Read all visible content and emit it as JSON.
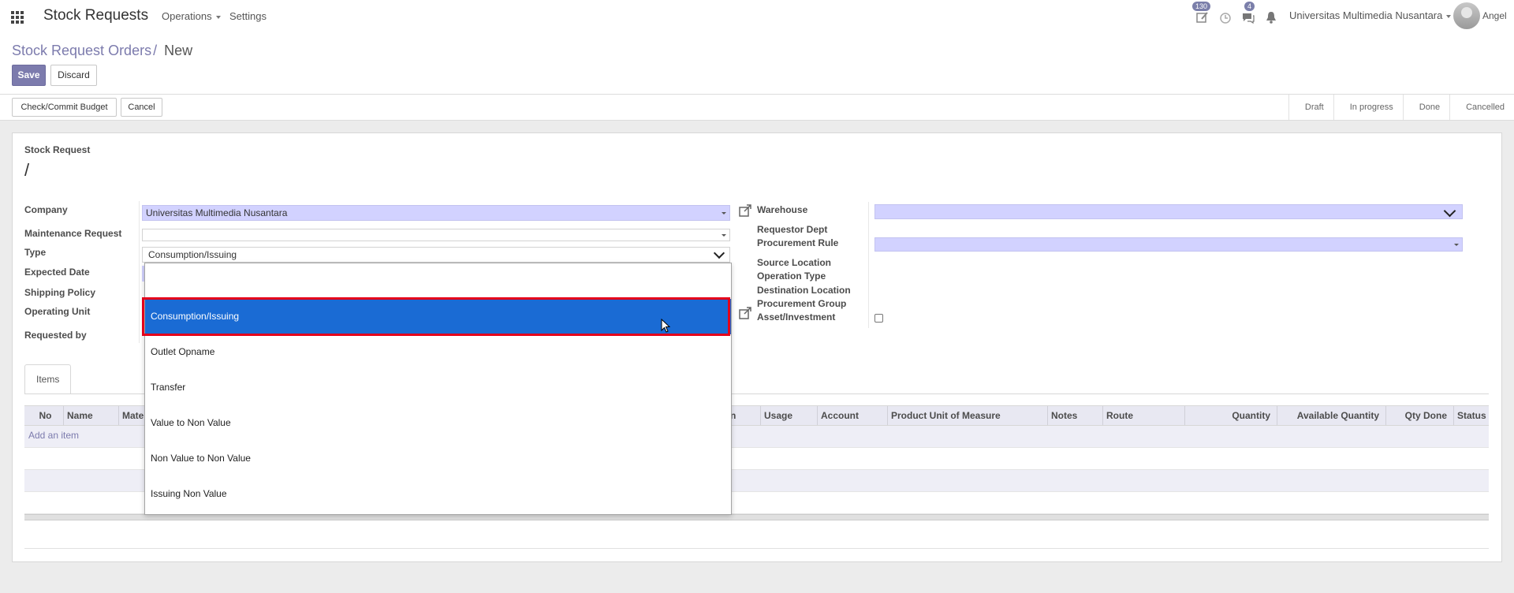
{
  "navbar": {
    "app_title": "Stock Requests",
    "menu_operations": "Operations",
    "menu_settings": "Settings",
    "activity_count": "130",
    "messages_count": "4",
    "company": "Universitas Multimedia Nusantara",
    "user": "Angel"
  },
  "breadcrumb": {
    "parent": "Stock Request Orders",
    "separator": "/",
    "current": "New"
  },
  "buttons": {
    "save": "Save",
    "discard": "Discard",
    "check_budget": "Check/Commit Budget",
    "cancel": "Cancel"
  },
  "statusbar": {
    "stages": [
      "Draft",
      "In progress",
      "Done",
      "Cancelled"
    ]
  },
  "form": {
    "title_label": "Stock Request",
    "name": "/",
    "left_labels": {
      "company": "Company",
      "maintenance": "Maintenance Request",
      "type": "Type",
      "expected_date": "Expected Date",
      "shipping_policy": "Shipping Policy",
      "operating_unit": "Operating Unit",
      "requested_by": "Requested by"
    },
    "company_value": "Universitas Multimedia Nusantara",
    "type_value": "Consumption/Issuing",
    "right_labels": {
      "warehouse": "Warehouse",
      "requestor_dept": "Requestor Dept",
      "procurement_rule": "Procurement Rule",
      "source_location": "Source Location",
      "operation_type": "Operation Type",
      "destination_location": "Destination Location",
      "procurement_group": "Procurement Group",
      "asset_investment": "Asset/Investment"
    }
  },
  "tabs": {
    "items": "Items"
  },
  "table": {
    "columns_left": [
      "No",
      "Name",
      "Mate"
    ],
    "columns_right": [
      "n",
      "Usage",
      "Account",
      "Product Unit of Measure",
      "Notes",
      "Route",
      "Quantity",
      "Available Quantity",
      "Qty Done",
      "Status"
    ],
    "add_item": "Add an item"
  },
  "type_dropdown": {
    "options": [
      "Consumption/Issuing",
      "Outlet Opname",
      "Transfer",
      "Value to Non Value",
      "Non Value to Non Value",
      "Issuing Non Value"
    ],
    "selected": "Consumption/Issuing"
  },
  "colors": {
    "brand": "#7c7bad",
    "required_field": "#d2d2ff",
    "selected_option": "#1a6bd4",
    "highlight": "#e3001b"
  }
}
